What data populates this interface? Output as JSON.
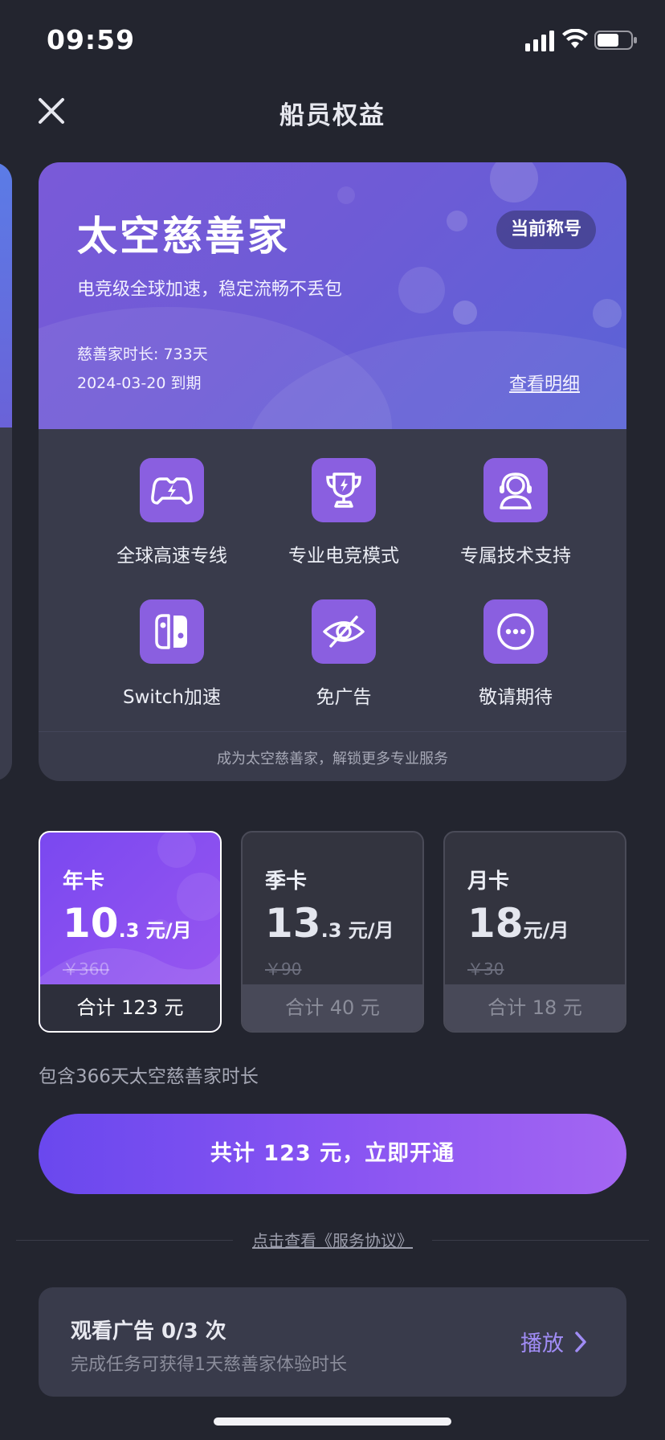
{
  "status_bar": {
    "time": "09:59"
  },
  "header": {
    "title": "船员权益"
  },
  "membership": {
    "title": "太空慈善家",
    "badge": "当前称号",
    "subtitle": "电竞级全球加速，稳定流畅不丢包",
    "duration": "慈善家时长: 733天",
    "expiry": "2024-03-20 到期",
    "detail_link": "查看明细",
    "accent_color": "#7a5ad8"
  },
  "benefits": [
    {
      "label": "全球高速专线",
      "icon": "gamepad-bolt-icon"
    },
    {
      "label": "专业电竞模式",
      "icon": "trophy-icon"
    },
    {
      "label": "专属技术支持",
      "icon": "headset-support-icon"
    },
    {
      "label": "Switch加速",
      "icon": "switch-console-icon"
    },
    {
      "label": "免广告",
      "icon": "eye-off-icon"
    },
    {
      "label": "敬请期待",
      "icon": "more-dots-icon"
    }
  ],
  "card_footer": "成为太空慈善家，解锁更多专业服务",
  "plans": [
    {
      "name": "年卡",
      "price_int": "10",
      "price_dec": ".3",
      "unit": " 元/月",
      "original": "￥360",
      "total": "合计 123 元",
      "selected": true
    },
    {
      "name": "季卡",
      "price_int": "13",
      "price_dec": ".3",
      "unit": " 元/月",
      "original": "￥90",
      "total": "合计 40 元",
      "selected": false
    },
    {
      "name": "月卡",
      "price_int": "18",
      "price_dec": "",
      "unit": "元/月",
      "original": "￥30",
      "total": "合计 18 元",
      "selected": false
    }
  ],
  "includes_text": "包含366天太空慈善家时长",
  "cta_label": "共计 123 元，立即开通",
  "agreement": "点击查看《服务协议》",
  "task": {
    "title": "观看广告 0/3 次",
    "desc": "完成任务可获得1天慈善家体验时长",
    "action": "播放"
  }
}
